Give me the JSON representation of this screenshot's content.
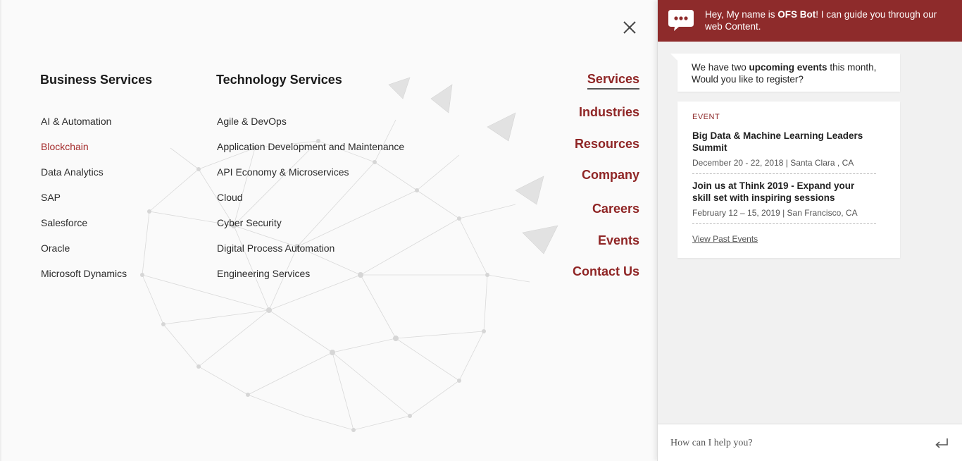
{
  "menu": {
    "close_icon": "close-icon",
    "business": {
      "title": "Business Services",
      "items": [
        "AI & Automation",
        "Blockchain",
        "Data Analytics",
        "SAP",
        "Salesforce",
        "Oracle",
        "Microsoft Dynamics"
      ],
      "active_item": "Blockchain"
    },
    "technology": {
      "title": "Technology Services",
      "items": [
        "Agile & DevOps",
        "Application Development and Maintenance",
        "API Economy & Microservices",
        "Cloud",
        "Cyber Security",
        "Digital Process Automation",
        "Engineering Services"
      ]
    },
    "main_nav": {
      "items": [
        "Services",
        "Industries",
        "Resources",
        "Company",
        "Careers",
        "Events",
        "Contact Us"
      ],
      "current": "Services"
    }
  },
  "chat": {
    "avatar_icon": "chat-bubble-icon",
    "greeting_pre": "Hey, My name is ",
    "bot_name": "OFS Bot",
    "greeting_post": "! I can guide you through our web Content.",
    "message_pre": "We have two ",
    "message_bold": "upcoming events",
    "message_post": " this month, Would you like to register?",
    "event_label": "EVENT",
    "events": [
      {
        "title": "Big Data & Machine Learning Leaders Summit",
        "meta": "December 20 - 22, 2018 | Santa Clara , CA"
      },
      {
        "title": "Join us at Think 2019 - Expand your skill set with inspiring sessions",
        "meta": "February 12 – 15, 2019 | San Francisco, CA"
      }
    ],
    "view_past": "View Past Events",
    "input_placeholder": "How can I help you?",
    "send_icon": "enter-return-icon"
  },
  "colors": {
    "accent": "#8e2b2b",
    "active_link": "#a32a2a"
  }
}
